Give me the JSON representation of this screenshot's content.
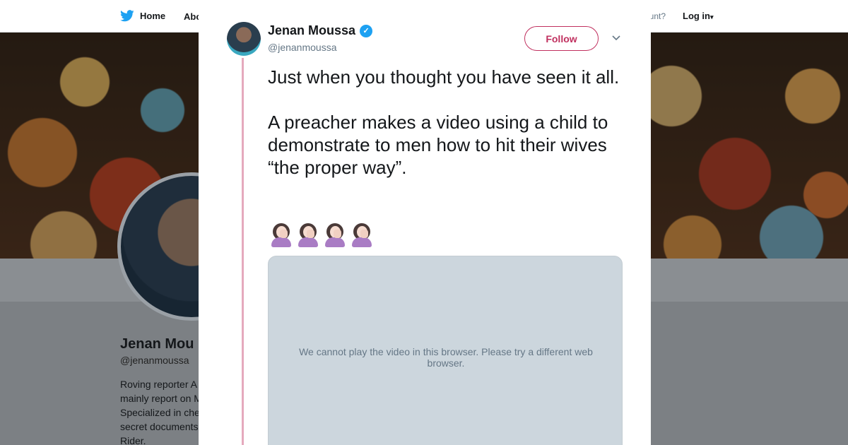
{
  "nav": {
    "home_label": "Home",
    "about_label": "Abo",
    "account_prompt": "ccount?",
    "login_label": "Log in"
  },
  "profile": {
    "name": "Jenan Mou",
    "handle": "@jenanmoussa",
    "bio_lines": [
      "Roving reporter A",
      "mainly report on M",
      "Specialized in che",
      "secret documents",
      "Rider."
    ]
  },
  "tweet": {
    "author_name": "Jenan Moussa",
    "author_handle": "@jenanmoussa",
    "follow_label": "Follow",
    "text": "Just when you thought you have seen it all.\n\nA preacher makes a video using a child to demonstrate to men how to hit their wives “the proper way”.",
    "emoji": [
      "face-palm-woman-icon",
      "face-palm-woman-icon",
      "face-palm-woman-icon",
      "face-palm-woman-icon"
    ],
    "video_message": "We cannot play the video in this browser. Please try a different web browser."
  },
  "colors": {
    "brand": "#1da1f2",
    "accent": "#c0305f",
    "thread_line": "#e5a9bd"
  }
}
